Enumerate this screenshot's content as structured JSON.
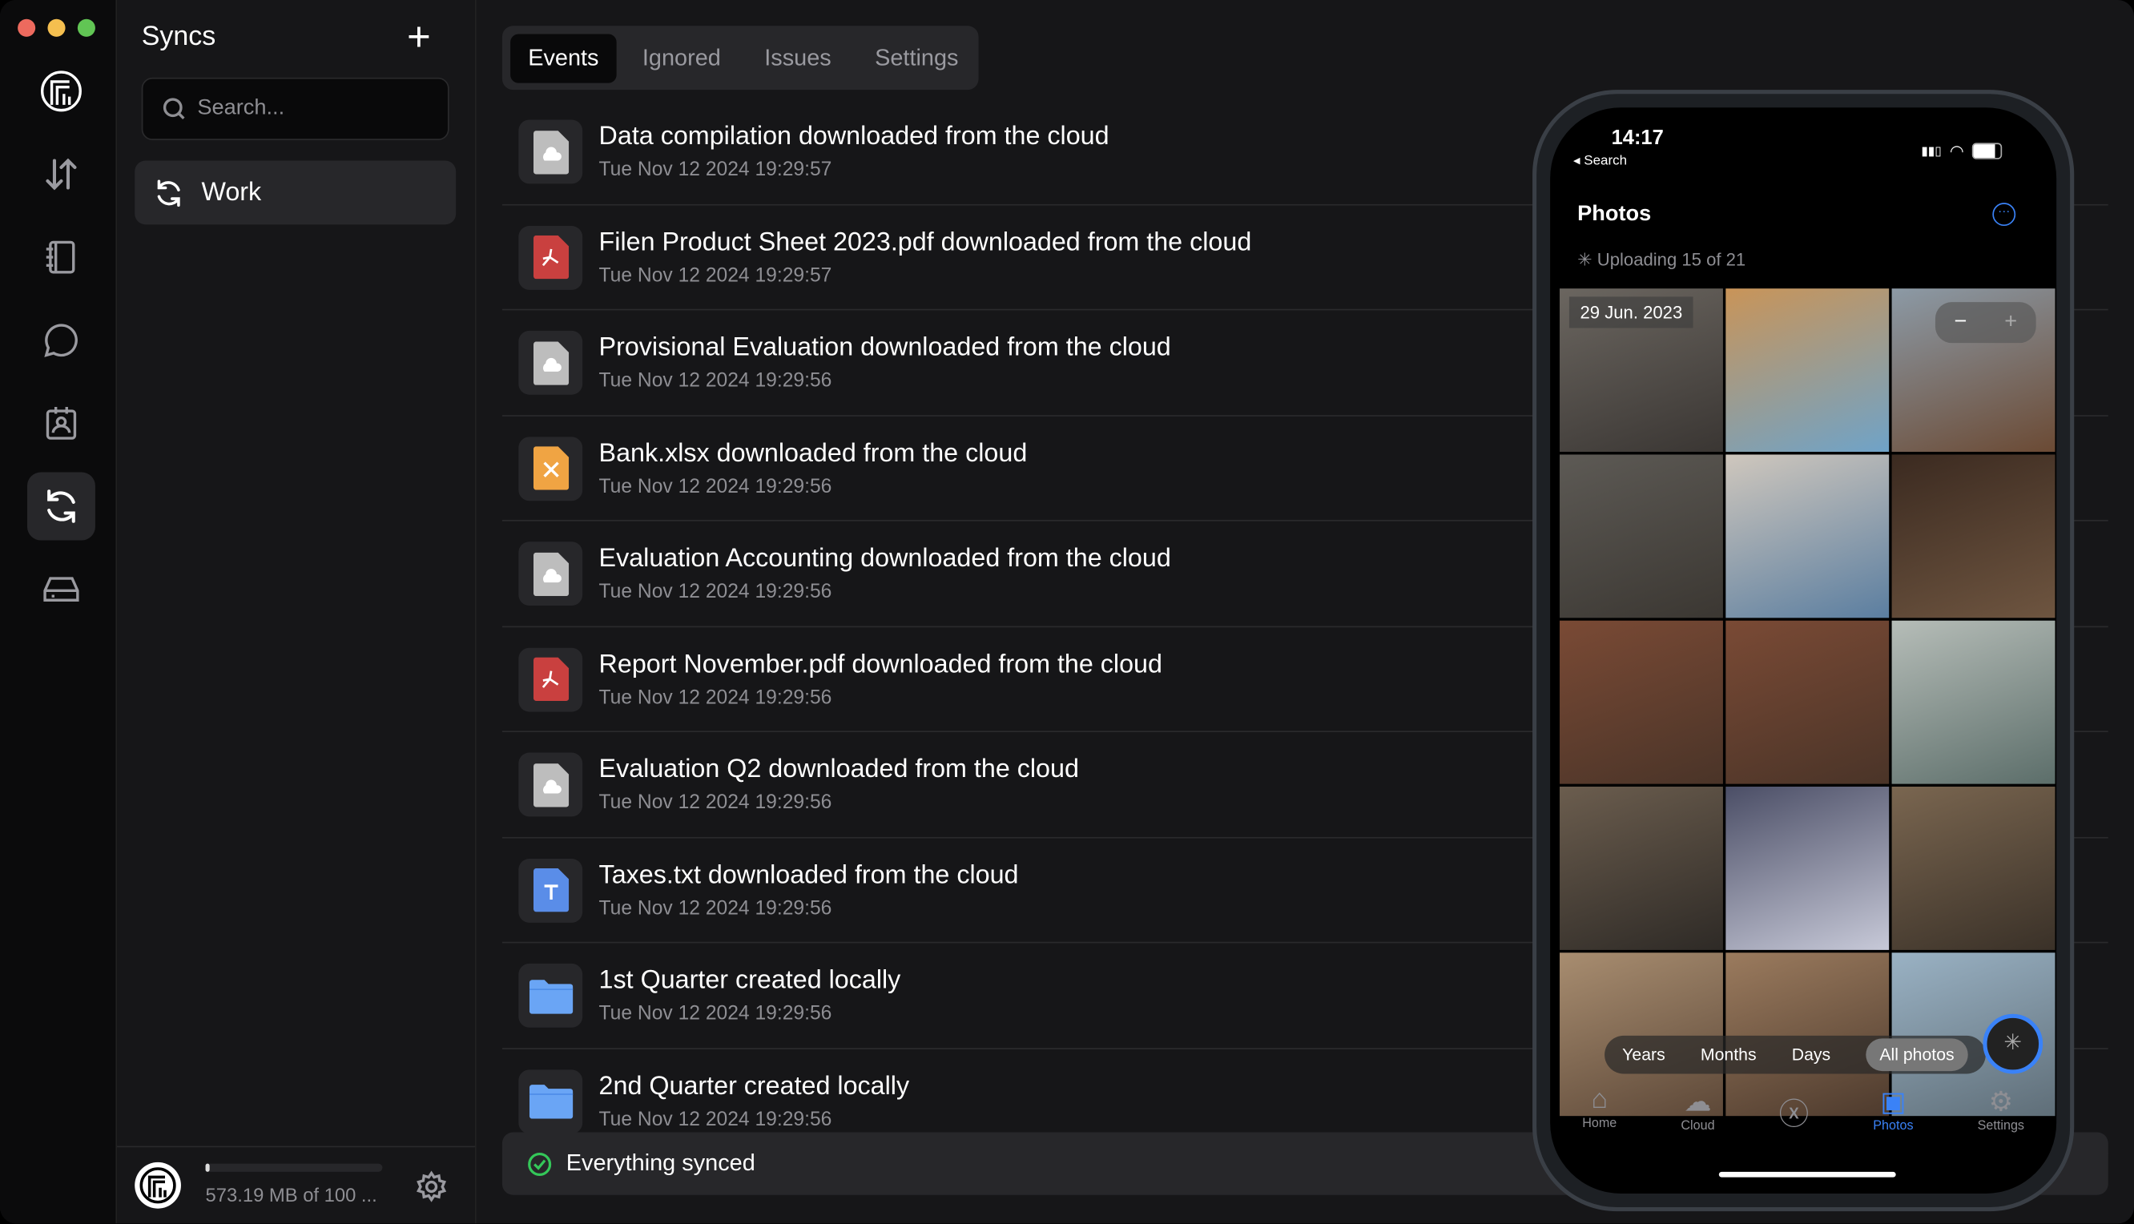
{
  "window": {
    "controls": {
      "close": "#ed6a5e",
      "minimize": "#f5bf4f",
      "zoom": "#61c554"
    }
  },
  "rail": {
    "items": [
      {
        "name": "logo"
      },
      {
        "name": "transfers"
      },
      {
        "name": "notes"
      },
      {
        "name": "chats"
      },
      {
        "name": "contacts"
      },
      {
        "name": "syncs",
        "active": true
      },
      {
        "name": "drive"
      }
    ]
  },
  "panel": {
    "title": "Syncs",
    "add_icon": "plus-icon",
    "search_placeholder": "Search...",
    "syncs": [
      {
        "label": "Work"
      }
    ],
    "storage": {
      "text": "573.19 MB of 100 ...",
      "used_fraction": 0.0057
    }
  },
  "tabs": [
    {
      "label": "Events",
      "active": true
    },
    {
      "label": "Ignored"
    },
    {
      "label": "Issues"
    },
    {
      "label": "Settings"
    }
  ],
  "events": [
    {
      "title": "Data compilation downloaded from the cloud",
      "date": "Tue Nov 12 2024 19:29:57",
      "icon": "generic"
    },
    {
      "title": "Filen Product Sheet 2023.pdf downloaded from the cloud",
      "date": "Tue Nov 12 2024 19:29:57",
      "icon": "pdf"
    },
    {
      "title": "Provisional Evaluation downloaded from the cloud",
      "date": "Tue Nov 12 2024 19:29:56",
      "icon": "generic"
    },
    {
      "title": "Bank.xlsx downloaded from the cloud",
      "date": "Tue Nov 12 2024 19:29:56",
      "icon": "xlsx"
    },
    {
      "title": "Evaluation Accounting downloaded from the cloud",
      "date": "Tue Nov 12 2024 19:29:56",
      "icon": "generic"
    },
    {
      "title": "Report November.pdf downloaded from the cloud",
      "date": "Tue Nov 12 2024 19:29:56",
      "icon": "pdf"
    },
    {
      "title": "Evaluation Q2 downloaded from the cloud",
      "date": "Tue Nov 12 2024 19:29:56",
      "icon": "generic"
    },
    {
      "title": "Taxes.txt downloaded from the cloud",
      "date": "Tue Nov 12 2024 19:29:56",
      "icon": "txt"
    },
    {
      "title": "1st Quarter created locally",
      "date": "Tue Nov 12 2024 19:29:56",
      "icon": "folder"
    },
    {
      "title": "2nd Quarter created locally",
      "date": "Tue Nov 12 2024 19:29:56",
      "icon": "folder"
    }
  ],
  "status": {
    "text": "Everything synced",
    "color": "#34c759"
  },
  "phone": {
    "time": "14:17",
    "back": "◂ Search",
    "title": "Photos",
    "uploading": "Uploading 15 of 21",
    "date_label": "29 Jun. 2023",
    "zoom_minus": "−",
    "zoom_plus": "+",
    "scales": [
      "Years",
      "Months",
      "Days",
      "All photos"
    ],
    "tabbar": [
      {
        "label": "Home"
      },
      {
        "label": "Cloud"
      },
      {
        "label": ""
      },
      {
        "label": "Photos",
        "active": true
      },
      {
        "label": "Settings"
      }
    ],
    "accent": "#3a82f7"
  }
}
